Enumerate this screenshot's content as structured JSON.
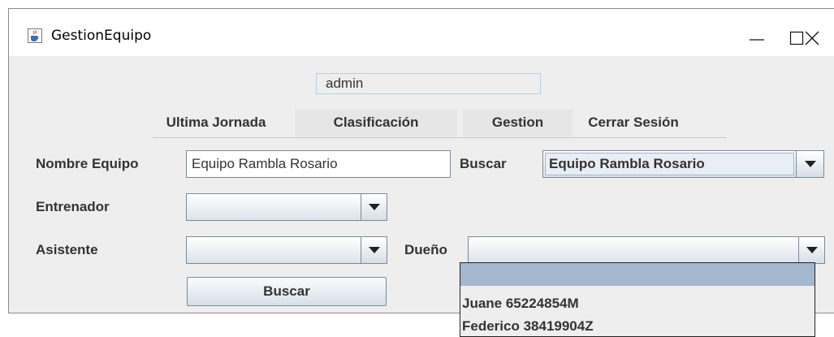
{
  "window": {
    "title": "GestionEquipo"
  },
  "header": {
    "user": "admin"
  },
  "menu": {
    "items": [
      "Ultima Jornada",
      "Clasificación",
      "Gestion",
      "Cerrar Sesión"
    ]
  },
  "form": {
    "nombre_label": "Nombre  Equipo",
    "nombre_value": "Equipo Rambla Rosario",
    "buscar_label": "Buscar",
    "buscar_selected": "Equipo Rambla Rosario",
    "entrenador_label": "Entrenador",
    "entrenador_value": "",
    "asistente_label": "Asistente",
    "asistente_value": "",
    "dueno_label": "Dueño",
    "dueno_value": "",
    "buscar_button": "Buscar"
  },
  "dueno_dropdown": {
    "options": [
      "",
      "Juane 65224854M",
      "Federico 38419904Z"
    ],
    "selected_index": 0
  },
  "colors": {
    "window_bg": "#eeeeee",
    "selection": "#a3b8cc",
    "border": "#7a8a99"
  },
  "icons": {
    "app": "java-cup-icon",
    "minimize": "minimize-icon",
    "maximize": "maximize-icon",
    "close": "close-icon",
    "combo": "triangle-down-icon"
  }
}
